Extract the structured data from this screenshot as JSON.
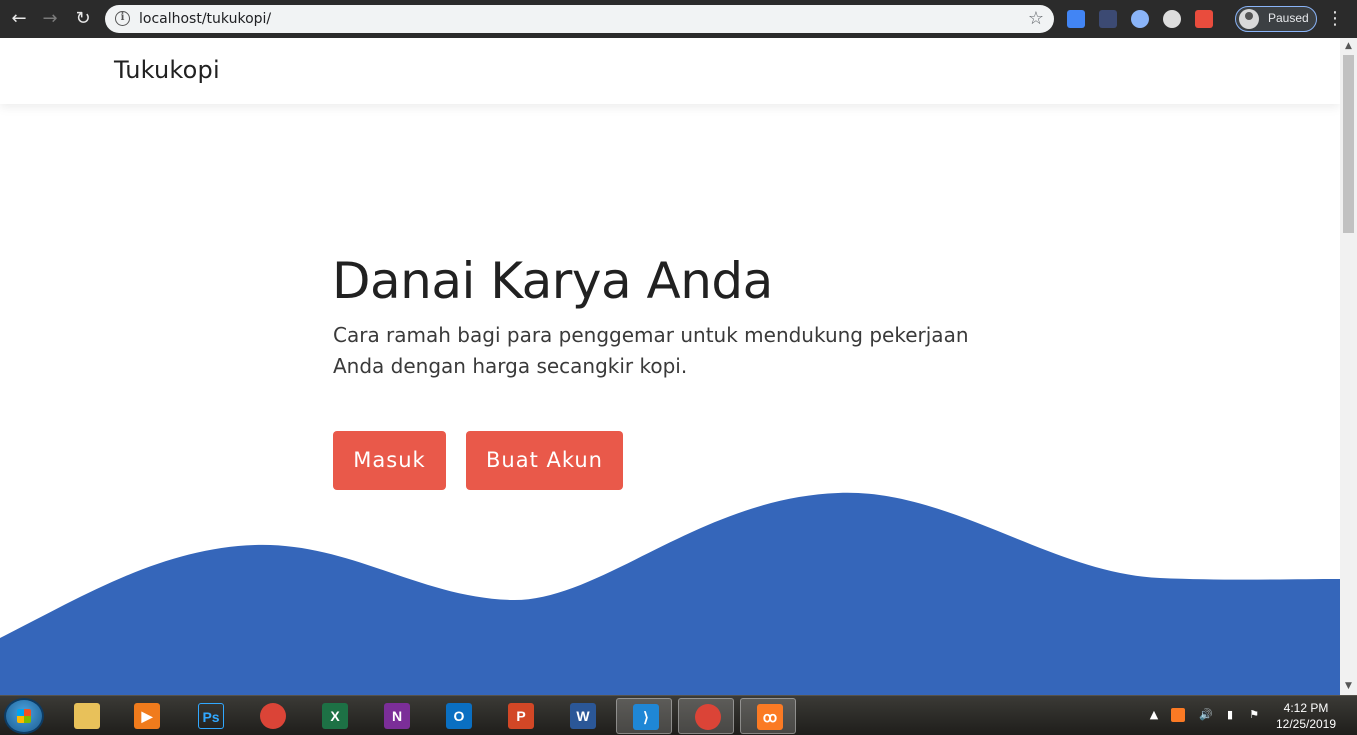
{
  "browser": {
    "back_glyph": "←",
    "forward_glyph": "→",
    "reload_glyph": "↻",
    "url": "localhost/tukukopi/",
    "info_glyph": "i",
    "bookmark_glyph": "☆",
    "profile_label": "Paused",
    "menu_glyph": "⋮",
    "extensions": [
      {
        "icon": "google-translate-icon",
        "color": "#4285f4"
      },
      {
        "icon": "extension-icon",
        "color": "#3c4a73"
      },
      {
        "icon": "circle-extension-icon",
        "color": "#8ab4f8"
      },
      {
        "icon": "react-devtools-icon",
        "color": "#dddddd"
      },
      {
        "icon": "screen-recorder-icon",
        "color": "#e94c3d"
      }
    ]
  },
  "site": {
    "brand": "Tukukopi",
    "hero": {
      "title": "Danai Karya Anda",
      "subtitle": "Cara ramah bagi para penggemar untuk mendukung pekerjaan Anda dengan harga secangkir kopi."
    },
    "buttons": {
      "login": "Masuk",
      "register": "Buat Akun"
    },
    "colors": {
      "button": "#e9594a",
      "wave": "#3566ba",
      "text": "#212121"
    }
  },
  "scrollbar": {
    "up_glyph": "▲",
    "down_glyph": "▼"
  },
  "taskbar": {
    "apps": [
      {
        "name": "file-explorer",
        "icon": "folder-icon",
        "glyph": "",
        "color": "#e8c15a"
      },
      {
        "name": "media-player",
        "icon": "media-player-icon",
        "glyph": "▶",
        "color": "#f07b1c"
      },
      {
        "name": "photoshop",
        "icon": "photoshop-icon",
        "glyph": "Ps",
        "color": "#0b1c3d"
      },
      {
        "name": "chrome",
        "icon": "chrome-icon",
        "glyph": "",
        "color": "#db4437"
      },
      {
        "name": "excel",
        "icon": "excel-icon",
        "glyph": "X",
        "color": "#1d7145"
      },
      {
        "name": "onenote",
        "icon": "onenote-icon",
        "glyph": "N",
        "color": "#7b2e98"
      },
      {
        "name": "outlook",
        "icon": "outlook-icon",
        "glyph": "O",
        "color": "#0a6fc2"
      },
      {
        "name": "powerpoint",
        "icon": "powerpoint-icon",
        "glyph": "P",
        "color": "#d24726"
      },
      {
        "name": "word",
        "icon": "word-icon",
        "glyph": "W",
        "color": "#2b5797"
      },
      {
        "name": "vscode",
        "icon": "vscode-icon",
        "glyph": "⟩",
        "color": "#1f87d6"
      },
      {
        "name": "chrome-active",
        "icon": "chrome-icon",
        "glyph": "",
        "color": "#db4437"
      },
      {
        "name": "xampp",
        "icon": "xampp-icon",
        "glyph": "ꝏ",
        "color": "#fb7a24"
      }
    ],
    "tray": {
      "show_hidden_glyph": "▲",
      "volume_glyph": "🔊",
      "signal_glyph": "▮",
      "flag_glyph": "⚑",
      "time": "4:12 PM",
      "date": "12/25/2019"
    }
  }
}
